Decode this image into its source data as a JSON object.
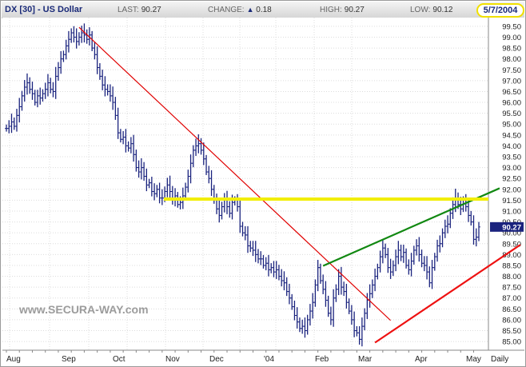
{
  "header": {
    "ticker": "DX [30] - US Dollar",
    "last_label": "LAST:",
    "last_value": "90.27",
    "change_label": "CHANGE:",
    "change_value": "0.18",
    "high_label": "HIGH:",
    "high_value": "90.27",
    "low_label": "LOW:",
    "low_value": "90.12",
    "date": "5/7/2004"
  },
  "watermark": "www.SECURA-WAY.com",
  "colors": {
    "price": "#1a237e",
    "downtrend": "#e00000",
    "uptrend_green": "#118811",
    "uptrend_red": "#ee1111",
    "resistance": "#f2ee00",
    "last_tag": "#1a237e"
  },
  "chart_data": {
    "type": "bar",
    "style": "ohlc-daily",
    "x_tick_labels": [
      "Aug",
      "Sep",
      "Oct",
      "Nov",
      "Dec",
      "'04",
      "Feb",
      "Mar",
      "Apr",
      "May"
    ],
    "x_axis_label": "Daily",
    "y_tick_labels": [
      "85.00",
      "85.50",
      "86.00",
      "86.50",
      "87.00",
      "87.50",
      "88.00",
      "88.50",
      "89.00",
      "89.50",
      "90.00",
      "90.50",
      "91.00",
      "91.50",
      "92.00",
      "92.50",
      "93.00",
      "93.50",
      "94.00",
      "94.50",
      "95.00",
      "95.50",
      "96.00",
      "96.50",
      "97.00",
      "97.50",
      "98.00",
      "98.50",
      "99.00",
      "99.50"
    ],
    "ylim": [
      84.6,
      99.9
    ],
    "grid": true,
    "last_price_tag": "90.27",
    "series": [
      {
        "values": [
          [
            0,
            94.8
          ],
          [
            1,
            94.9
          ],
          [
            2,
            95.1
          ],
          [
            3,
            94.9
          ],
          [
            4,
            95.4
          ],
          [
            5,
            95.8
          ],
          [
            6,
            96.3
          ],
          [
            7,
            96.7
          ],
          [
            8,
            96.9
          ],
          [
            9,
            96.6
          ],
          [
            10,
            96.4
          ],
          [
            11,
            96.0
          ],
          [
            12,
            96.3
          ],
          [
            13,
            96.2
          ],
          [
            14,
            96.4
          ],
          [
            15,
            96.6
          ],
          [
            16,
            96.9
          ],
          [
            17,
            96.6
          ],
          [
            18,
            96.5
          ],
          [
            19,
            97.2
          ],
          [
            20,
            97.6
          ],
          [
            21,
            98.0
          ],
          [
            22,
            98.2
          ],
          [
            23,
            98.6
          ],
          [
            24,
            98.9
          ],
          [
            25,
            99.2
          ],
          [
            26,
            99.0
          ],
          [
            27,
            98.8
          ],
          [
            28,
            99.0
          ],
          [
            29,
            99.2
          ],
          [
            30,
            99.1
          ],
          [
            31,
            98.9
          ],
          [
            32,
            99.1
          ],
          [
            33,
            98.5
          ],
          [
            34,
            98.2
          ],
          [
            35,
            97.6
          ],
          [
            36,
            97.2
          ],
          [
            37,
            96.8
          ],
          [
            38,
            96.6
          ],
          [
            39,
            96.5
          ],
          [
            40,
            96.3
          ],
          [
            41,
            96.0
          ],
          [
            42,
            95.4
          ],
          [
            43,
            94.6
          ],
          [
            44,
            94.3
          ],
          [
            45,
            94.4
          ],
          [
            46,
            94.0
          ],
          [
            47,
            93.9
          ],
          [
            48,
            94.1
          ],
          [
            49,
            93.6
          ],
          [
            50,
            93.0
          ],
          [
            51,
            92.8
          ],
          [
            52,
            93.0
          ],
          [
            53,
            92.6
          ],
          [
            54,
            92.2
          ],
          [
            55,
            92.3
          ],
          [
            56,
            91.9
          ],
          [
            57,
            91.8
          ],
          [
            58,
            92.0
          ],
          [
            59,
            91.6
          ],
          [
            60,
            91.6
          ],
          [
            61,
            91.9
          ],
          [
            62,
            92.2
          ],
          [
            63,
            91.9
          ],
          [
            64,
            91.5
          ],
          [
            65,
            91.7
          ],
          [
            66,
            91.3
          ],
          [
            67,
            91.4
          ],
          [
            68,
            91.7
          ],
          [
            69,
            92.1
          ],
          [
            70,
            92.6
          ],
          [
            71,
            93.2
          ],
          [
            72,
            93.8
          ],
          [
            73,
            94.0
          ],
          [
            74,
            94.1
          ],
          [
            75,
            93.8
          ],
          [
            76,
            93.4
          ],
          [
            77,
            92.8
          ],
          [
            78,
            92.5
          ],
          [
            79,
            92.0
          ],
          [
            80,
            91.5
          ],
          [
            81,
            91.1
          ],
          [
            82,
            90.8
          ],
          [
            83,
            91.2
          ],
          [
            84,
            91.5
          ],
          [
            85,
            91.2
          ],
          [
            86,
            90.9
          ],
          [
            87,
            91.4
          ],
          [
            88,
            91.5
          ],
          [
            89,
            91.2
          ],
          [
            90,
            90.3
          ],
          [
            91,
            90.0
          ],
          [
            92,
            89.9
          ],
          [
            93,
            89.4
          ],
          [
            94,
            89.3
          ],
          [
            95,
            89.2
          ],
          [
            96,
            89.0
          ],
          [
            97,
            88.8
          ],
          [
            98,
            88.8
          ],
          [
            99,
            88.5
          ],
          [
            100,
            88.6
          ],
          [
            101,
            88.3
          ],
          [
            102,
            88.4
          ],
          [
            103,
            88.2
          ],
          [
            104,
            88.3
          ],
          [
            105,
            88.0
          ],
          [
            106,
            87.8
          ],
          [
            107,
            87.7
          ],
          [
            108,
            87.3
          ],
          [
            109,
            87.0
          ],
          [
            110,
            86.6
          ],
          [
            111,
            86.2
          ],
          [
            112,
            85.9
          ],
          [
            113,
            85.6
          ],
          [
            114,
            85.7
          ],
          [
            115,
            85.5
          ],
          [
            116,
            86.0
          ],
          [
            117,
            86.4
          ],
          [
            118,
            86.8
          ],
          [
            119,
            87.6
          ],
          [
            120,
            88.4
          ],
          [
            121,
            87.8
          ],
          [
            122,
            87.4
          ],
          [
            123,
            86.9
          ],
          [
            124,
            86.3
          ],
          [
            125,
            86.0
          ],
          [
            126,
            87.0
          ],
          [
            127,
            87.4
          ],
          [
            128,
            88.0
          ],
          [
            129,
            87.5
          ],
          [
            130,
            87.3
          ],
          [
            131,
            86.8
          ],
          [
            132,
            86.4
          ],
          [
            133,
            86.0
          ],
          [
            134,
            85.5
          ],
          [
            135,
            85.4
          ],
          [
            136,
            85.1
          ],
          [
            137,
            85.7
          ],
          [
            138,
            86.3
          ],
          [
            139,
            86.9
          ],
          [
            140,
            87.2
          ],
          [
            141,
            87.6
          ],
          [
            142,
            88.0
          ],
          [
            143,
            88.4
          ],
          [
            144,
            88.9
          ],
          [
            145,
            89.3
          ],
          [
            146,
            89.0
          ],
          [
            147,
            88.4
          ],
          [
            148,
            88.2
          ],
          [
            149,
            88.5
          ],
          [
            150,
            88.9
          ],
          [
            151,
            89.2
          ],
          [
            152,
            88.9
          ],
          [
            153,
            89.1
          ],
          [
            154,
            88.5
          ],
          [
            155,
            88.3
          ],
          [
            156,
            88.7
          ],
          [
            157,
            89.2
          ],
          [
            158,
            89.4
          ],
          [
            159,
            89.0
          ],
          [
            160,
            88.6
          ],
          [
            161,
            88.5
          ],
          [
            162,
            88.2
          ],
          [
            163,
            87.7
          ],
          [
            164,
            88.4
          ],
          [
            165,
            88.9
          ],
          [
            166,
            89.4
          ],
          [
            167,
            89.5
          ],
          [
            168,
            90.0
          ],
          [
            169,
            90.3
          ],
          [
            170,
            90.4
          ],
          [
            171,
            90.9
          ],
          [
            172,
            91.3
          ],
          [
            173,
            91.6
          ],
          [
            174,
            91.3
          ],
          [
            175,
            91.1
          ],
          [
            176,
            91.5
          ],
          [
            177,
            91.2
          ],
          [
            178,
            90.8
          ],
          [
            179,
            90.5
          ],
          [
            180,
            89.7
          ],
          [
            181,
            89.8
          ],
          [
            182,
            90.27
          ]
        ]
      }
    ]
  }
}
